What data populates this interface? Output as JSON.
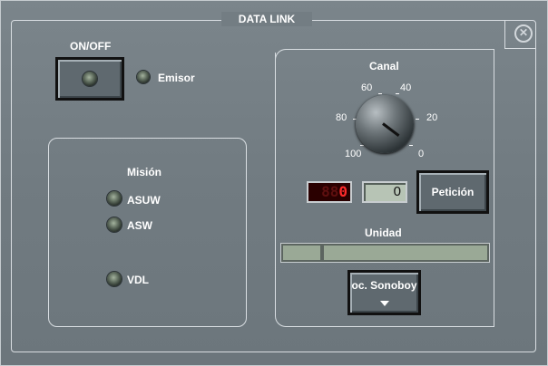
{
  "window": {
    "title": "DATA LINK"
  },
  "onoff": {
    "label": "ON/OFF"
  },
  "emisor": {
    "label": "Emisor"
  },
  "mision": {
    "title": "Misión",
    "options": [
      "ASUW",
      "ASW",
      "VDL"
    ]
  },
  "canal": {
    "title": "Canal",
    "scale": [
      "100",
      "80",
      "60",
      "40",
      "20",
      "0"
    ],
    "display_dim": "88",
    "display_value": "0",
    "field_value": "0"
  },
  "peticion": {
    "label": "Petición"
  },
  "unidad": {
    "title": "Unidad"
  },
  "sonoboy": {
    "label": "oc. Sonoboy"
  },
  "icons": {
    "close": "close-icon",
    "dropdown": "chevron-down-icon"
  }
}
